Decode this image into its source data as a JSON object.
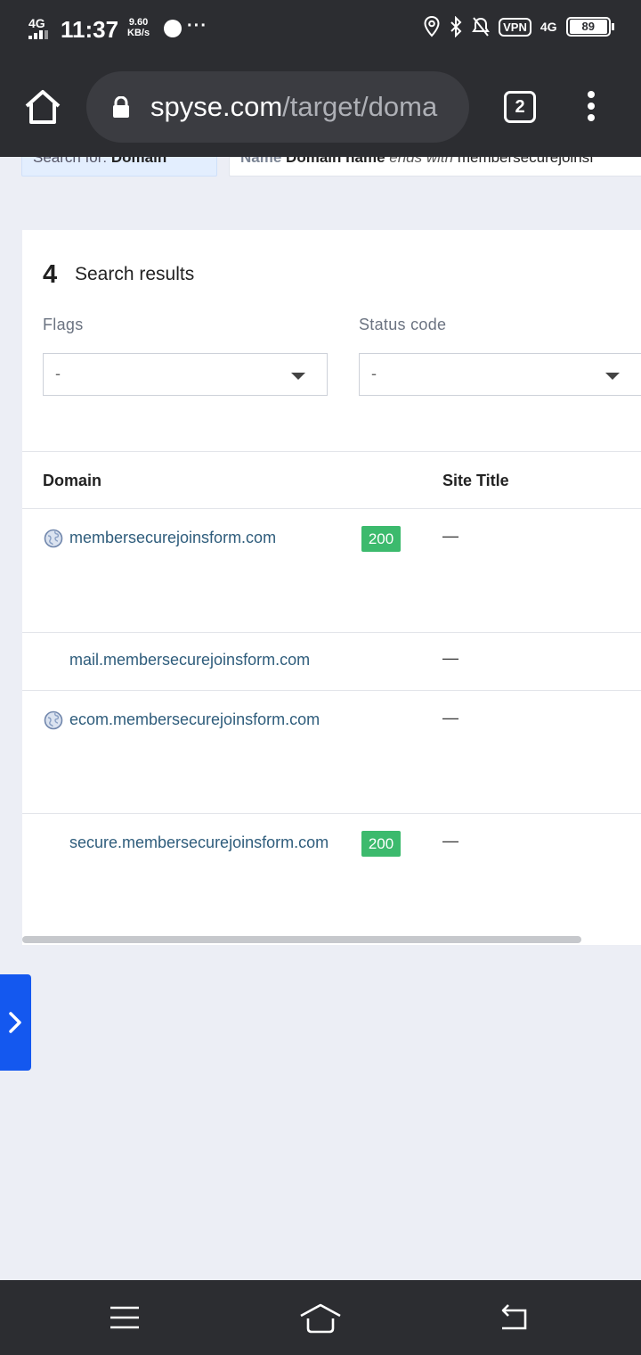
{
  "status_bar": {
    "network": "4G",
    "time": "11:37",
    "speed_value": "9.60",
    "speed_unit": "KB/s",
    "more_indicator": "···",
    "vpn": "VPN",
    "mobile_data": "4G",
    "battery": "89",
    "icons": [
      "signal-icon",
      "messenger-icon",
      "location-icon",
      "bluetooth-icon",
      "mute-icon",
      "vpn-icon",
      "battery-icon"
    ]
  },
  "browser": {
    "url_host": "spyse.com",
    "url_path": "/target/doma",
    "tab_count": "2",
    "icons": [
      "home-icon",
      "lock-icon",
      "tabs-icon",
      "more-vert-icon"
    ]
  },
  "filters_bar": {
    "search_for_label": "Search for:",
    "search_for_value": "Domain",
    "criteria_key": "Name",
    "criteria_field": "Domain name",
    "criteria_op": "ends with",
    "criteria_value": "membersecurejoinsf"
  },
  "results": {
    "count": "4",
    "label": "Search results",
    "flags": {
      "label": "Flags",
      "value": "-"
    },
    "status_code": {
      "label": "Status code",
      "value": "-"
    },
    "columns": [
      "Domain",
      "Site Title"
    ],
    "rows": [
      {
        "domain": "membersecurejoinsform.com",
        "status": "200",
        "title": "—",
        "has_globe": true
      },
      {
        "domain": "mail.membersecurejoinsform.com",
        "status": "",
        "title": "—",
        "has_globe": false
      },
      {
        "domain": "ecom.membersecurejoinsform.com",
        "status": "",
        "title": "—",
        "has_globe": true
      },
      {
        "domain": "secure.membersecurejoinsform.com",
        "status": "200",
        "title": "—",
        "has_globe": false
      }
    ]
  },
  "colors": {
    "chrome_bg": "#2c2d31",
    "page_bg": "#eceef5",
    "link": "#2f5d7c",
    "status_ok": "#3cba6d",
    "accent": "#1458ef"
  }
}
